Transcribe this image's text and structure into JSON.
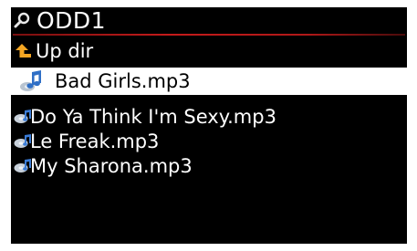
{
  "header": {
    "title": "ODD1",
    "icon": "search-icon"
  },
  "list": {
    "items": [
      {
        "label": "Up dir",
        "icon": "folder-up-arrow-icon",
        "selected": false
      },
      {
        "label": "Bad Girls.mp3",
        "icon": "music-note-icon",
        "selected": true
      },
      {
        "label": "Do Ya Think I'm Sexy.mp3",
        "icon": "music-disc-icon",
        "selected": false
      },
      {
        "label": "Le Freak.mp3",
        "icon": "music-disc-icon",
        "selected": false
      },
      {
        "label": "My Sharona.mp3",
        "icon": "music-disc-icon",
        "selected": false
      }
    ]
  },
  "colors": {
    "background": "#000000",
    "text": "#ffffff",
    "selection": "#ffffff",
    "accent_line": "#c41a1a",
    "up_arrow": "#f5a623",
    "music_icon": "#4a90e2"
  }
}
